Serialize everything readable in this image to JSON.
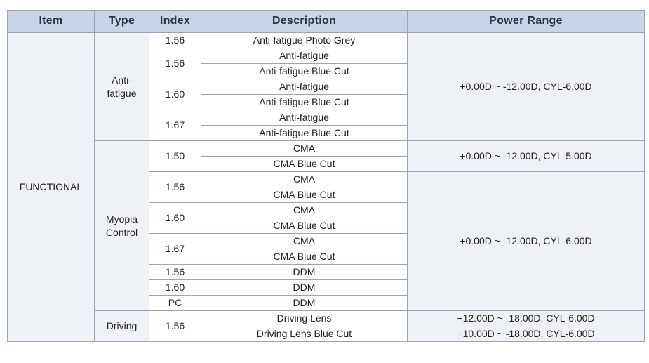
{
  "headers": {
    "item": "Item",
    "type": "Type",
    "index": "Index",
    "description": "Description",
    "power": "Power Range"
  },
  "item": "FUNCTIONAL",
  "types": {
    "anti_fatigue_l1": "Anti-",
    "anti_fatigue_l2": "fatigue",
    "myopia_l1": "Myopia",
    "myopia_l2": "Control",
    "driving": "Driving"
  },
  "index": {
    "r1": "1.56",
    "r2": "1.56",
    "r3": "1.60",
    "r4": "1.67",
    "r5": "1.50",
    "r6": "1.56",
    "r7": "1.60",
    "r8": "1.67",
    "r9": "1.56",
    "r10": "1.60",
    "r11": "PC",
    "r12": "1.56"
  },
  "desc": [
    "Anti-fatigue Photo Grey",
    "Anti-fatigue",
    "Anti-fatigue Blue Cut",
    "Anti-fatigue",
    "Anti-fatigue Blue Cut",
    "Anti-fatigue",
    "Anti-fatigue Blue Cut",
    "CMA",
    "CMA Blue Cut",
    "CMA",
    "CMA Blue Cut",
    "CMA",
    "CMA Blue Cut",
    "CMA",
    "CMA Blue Cut",
    "DDM",
    "DDM",
    "DDM",
    "Driving Lens",
    "Driving Lens Blue Cut"
  ],
  "power": {
    "p1": "+0.00D ~ -12.00D, CYL-6.00D",
    "p2": "+0.00D ~ -12.00D, CYL-5.00D",
    "p3": "+0.00D ~ -12.00D, CYL-6.00D",
    "p4": "+12.00D ~ -18.00D, CYL-6.00D",
    "p5": "+10.00D ~ -18.00D, CYL-6.00D"
  }
}
